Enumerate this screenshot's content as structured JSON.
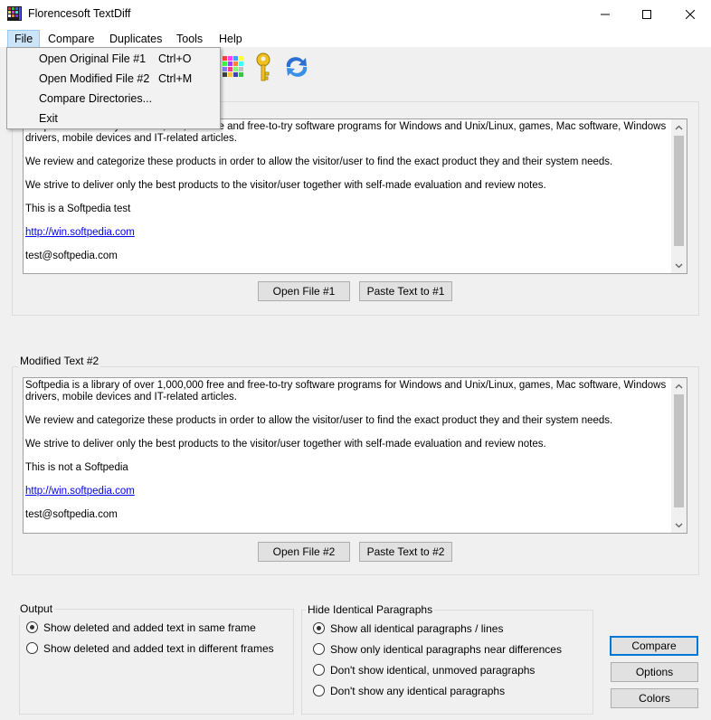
{
  "window": {
    "title": "Florencesoft TextDiff",
    "minimize_glyph": "—",
    "maximize_glyph": "☐",
    "close_glyph": "✕"
  },
  "menu": {
    "items": [
      "File",
      "Compare",
      "Duplicates",
      "Tools",
      "Help"
    ],
    "open_menu": "File",
    "file_dropdown": [
      {
        "label": "Open Original File #1",
        "shortcut": "Ctrl+O"
      },
      {
        "label": "Open Modified File #2",
        "shortcut": "Ctrl+M"
      },
      {
        "label": "Compare Directories...",
        "shortcut": ""
      },
      {
        "label": "Exit",
        "shortcut": ""
      }
    ]
  },
  "toolbar": {
    "icons": [
      "color-palette-icon",
      "key-icon",
      "refresh-arrows-icon"
    ]
  },
  "original": {
    "paragraphs": [
      "Softpedia is a library of over 1,000,000 free and free-to-try software programs for Windows and Unix/Linux, games, Mac software, Windows drivers, mobile devices and IT-related articles.",
      "We review and categorize these products in order to allow the visitor/user to find the exact product they and their system needs.",
      "We strive to deliver only the best products to the visitor/user together with self-made evaluation and review notes.",
      "This is a Softpedia test"
    ],
    "link": "http://win.softpedia.com",
    "email": "test@softpedia.com",
    "open_button": "Open File #1",
    "paste_button": "Paste Text to #1"
  },
  "modified": {
    "caption": "Modified Text #2",
    "paragraphs": [
      "Softpedia is a library of over 1,000,000 free and free-to-try software programs for Windows and Unix/Linux, games, Mac software, Windows drivers, mobile devices and IT-related articles.",
      "We review and categorize these products in order to allow the visitor/user to find the exact product they and their system needs.",
      "We strive to deliver only the best products to the visitor/user together with self-made evaluation and review notes.",
      "This is not a Softpedia"
    ],
    "link": "http://win.softpedia.com",
    "email": "test@softpedia.com",
    "open_button": "Open File #2",
    "paste_button": "Paste Text to #2"
  },
  "output": {
    "caption": "Output",
    "options": [
      {
        "label": "Show deleted and added text in same frame",
        "checked": true
      },
      {
        "label": "Show deleted and added text in different frames",
        "checked": false
      }
    ]
  },
  "hide": {
    "caption": "Hide Identical Paragraphs",
    "options": [
      {
        "label": "Show all identical paragraphs / lines",
        "checked": true
      },
      {
        "label": "Show only identical paragraphs near differences",
        "checked": false
      },
      {
        "label": "Don't show identical, unmoved paragraphs",
        "checked": false
      },
      {
        "label": "Don't show any identical paragraphs",
        "checked": false
      }
    ]
  },
  "actions": {
    "compare": "Compare",
    "options": "Options",
    "colors": "Colors"
  },
  "colors": {
    "accent": "#0078d7",
    "link": "#0000ee",
    "menu_highlight": "#cce4f7"
  }
}
